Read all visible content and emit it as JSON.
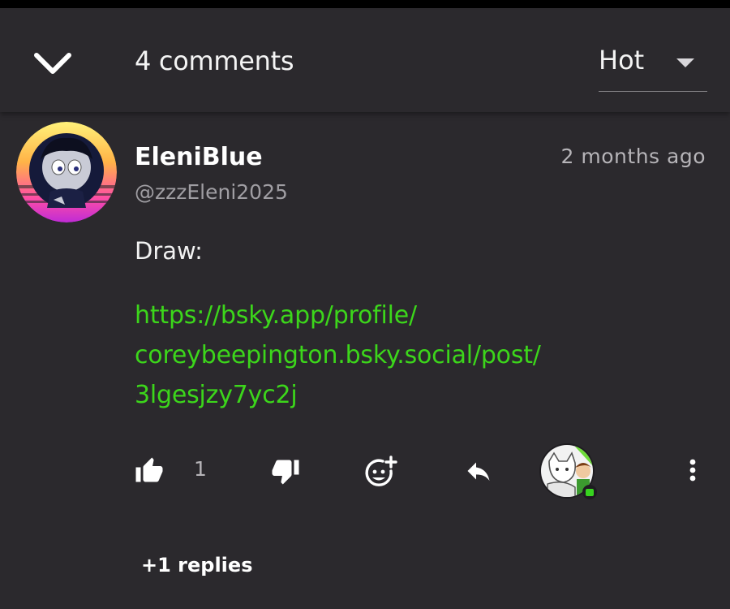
{
  "header": {
    "comment_count": "4 comments",
    "sort": {
      "selected": "Hot"
    }
  },
  "comment": {
    "username": "EleniBlue",
    "handle": "@zzzEleni2025",
    "timestamp": "2 months ago",
    "text": "Draw:",
    "link_lines": [
      "https://bsky.app/profile/",
      "coreybeepington.bsky.social/post/",
      "3lgesjzy7yc2j"
    ],
    "likes": "1",
    "replies": "+1 replies"
  },
  "icons": [
    "chevron-down-icon",
    "caret-down-icon",
    "thumbs-up-icon",
    "thumbs-down-icon",
    "add-reaction-icon",
    "reply-icon",
    "more-vertical-icon"
  ],
  "colors": {
    "background": "#2b292d",
    "link": "#3cd61b",
    "muted": "#a09ea3",
    "text": "#ffffff"
  }
}
